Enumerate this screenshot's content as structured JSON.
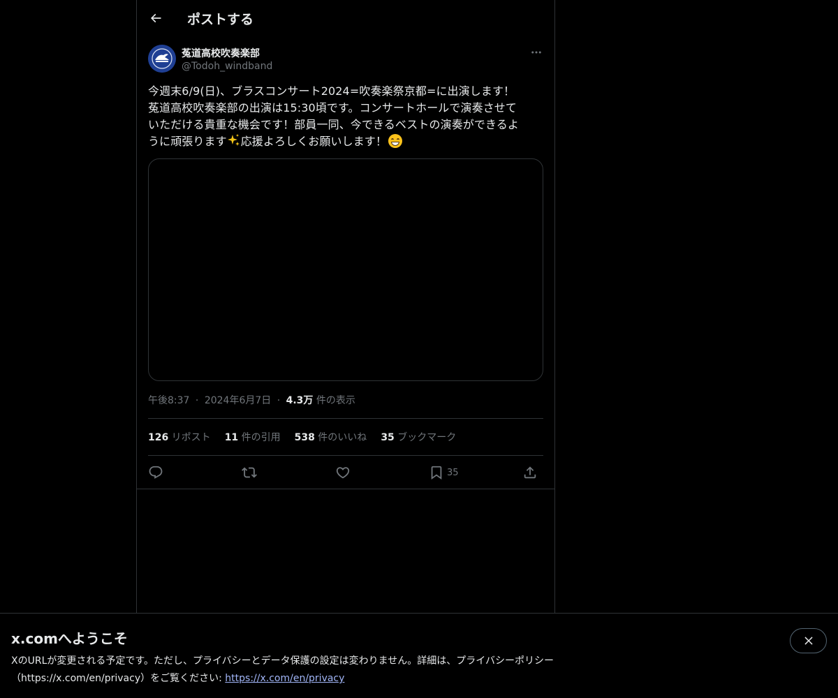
{
  "header": {
    "title": "ポストする"
  },
  "author": {
    "name": "菟道高校吹奏楽部",
    "handle": "@Todoh_windband"
  },
  "tweet": {
    "lines": [
      "今週末6/9(日)、ブラスコンサート2024=吹奏楽祭京都=に出演します！",
      "菟道高校吹奏楽部の出演は15:30頃です。コンサートホールで演奏させて",
      "いただける貴重な機会です！部員一同、今できるベストの演奏ができるよ",
      "うに頑張ります",
      "応援よろしくお願いします！"
    ]
  },
  "meta": {
    "time": "午後8:37",
    "sep": "·",
    "date": "2024年6月7日",
    "views": "4.3万",
    "views_label": " 件の表示"
  },
  "stats": {
    "reposts": "126",
    "reposts_label": " リポスト",
    "quotes": "11",
    "quotes_label": " 件の引用",
    "likes": "538",
    "likes_label": " 件のいいね",
    "bookmarks": "35",
    "bookmarks_label": " ブックマーク"
  },
  "actions": {
    "bookmark_count": "35"
  },
  "banner": {
    "title": "x.comへようこそ",
    "text": "XのURLが変更される予定です。ただし、プライバシーとデータ保護の設定は変わりません。詳細は、プライバシーポリシー（https://x.com/en/privacy）をご覧ください: ",
    "link": "https://x.com/en/privacy"
  },
  "icons": [
    "back-arrow-icon",
    "more-icon",
    "reply-icon",
    "repost-icon",
    "like-icon",
    "bookmark-icon",
    "share-icon",
    "close-icon"
  ]
}
